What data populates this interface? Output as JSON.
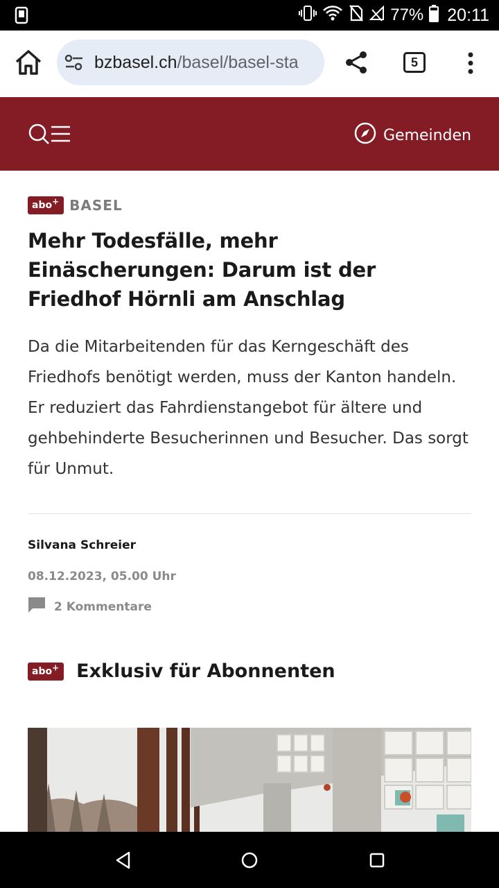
{
  "status_bar": {
    "battery": "77%",
    "time": "20:11"
  },
  "browser": {
    "url_host": "bzbasel.ch",
    "url_path": "/basel/basel-sta",
    "tab_count": "5",
    "load_progress": 0.8
  },
  "site_header": {
    "gemeinden_label": "Gemeinden"
  },
  "article": {
    "abo_label": "abo",
    "abo_plus": "+",
    "kicker": "BASEL",
    "headline": "Mehr Todesfälle, mehr Einäscherungen: Darum ist der Friedhof Hörnli am Anschlag",
    "lead": "Da die Mitarbeitenden für das Kerngeschäft des Friedhofs benötigt werden, muss der Kanton handeln. Er reduziert das Fahrdienstangebot für ältere und gehbehinderte Besucherinnen und Besucher. Das sorgt für Unmut.",
    "author": "Silvana Schreier",
    "date": "08.12.2023, 05.00 Uhr",
    "comments": "2 Kommentare",
    "exclusive_title": "Exklusiv für Abonnenten"
  },
  "colors": {
    "brand": "#841c25",
    "progress": "#2f63d8"
  }
}
